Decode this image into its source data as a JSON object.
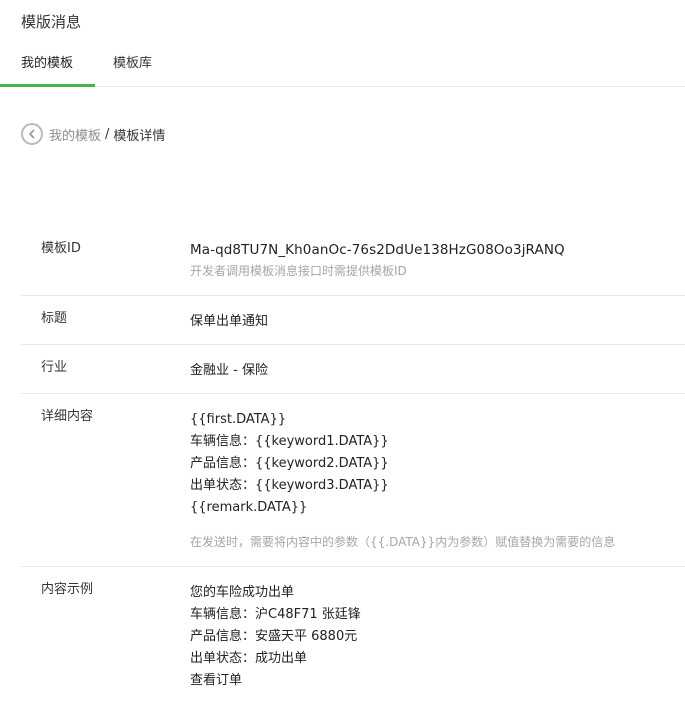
{
  "page": {
    "title": "模版消息"
  },
  "tabs": [
    {
      "label": "我的模板",
      "active": true
    },
    {
      "label": "模板库",
      "active": false
    }
  ],
  "breadcrumb": {
    "parent": "我的模板",
    "separator": "/",
    "current": "模板详情"
  },
  "detail": {
    "template_id": {
      "label": "模板ID",
      "value": "Ma-qd8TU7N_Kh0anOc-76s2DdUe138HzG08Oo3jRANQ",
      "hint": "开发者调用模板消息接口时需提供模板ID"
    },
    "title": {
      "label": "标题",
      "value": "保单出单通知"
    },
    "industry": {
      "label": "行业",
      "value": "金融业 - 保险"
    },
    "content": {
      "label": "详细内容",
      "lines": [
        "{{first.DATA}}",
        "车辆信息：{{keyword1.DATA}}",
        "产品信息：{{keyword2.DATA}}",
        "出单状态：{{keyword3.DATA}}",
        "{{remark.DATA}}"
      ],
      "hint": "在发送时，需要将内容中的参数（{{.DATA}}内为参数）赋值替换为需要的信息"
    },
    "example": {
      "label": "内容示例",
      "lines": [
        "您的车险成功出单",
        "车辆信息：沪C48F71 张廷锋",
        "产品信息：安盛天平 6880元",
        "出单状态：成功出单",
        "查看订单"
      ]
    }
  },
  "colors": {
    "accent": "#44b549",
    "hint": "#a6a6a6",
    "divider": "#e7e7eb"
  },
  "icons": {
    "back": "chevron-left-circle-icon"
  }
}
